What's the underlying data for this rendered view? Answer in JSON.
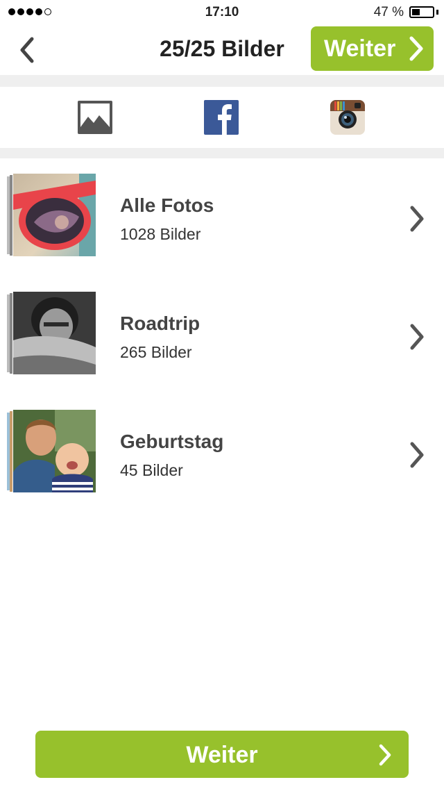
{
  "status": {
    "time": "17:10",
    "battery": "47 %",
    "battery_level": 0.47
  },
  "nav": {
    "title": "25/25 Bilder",
    "next_label": "Weiter"
  },
  "source_tabs": [
    {
      "icon": "gallery-icon",
      "selected": true
    },
    {
      "icon": "facebook-icon",
      "selected": false
    },
    {
      "icon": "instagram-icon",
      "selected": false
    }
  ],
  "albums": [
    {
      "name": "Alle Fotos",
      "count": "1028 Bilder",
      "icon": "photo-sunglasses"
    },
    {
      "name": "Roadtrip",
      "count": "265 Bilder",
      "icon": "photo-man-bw"
    },
    {
      "name": "Geburtstag",
      "count": "45 Bilder",
      "icon": "photo-father-baby"
    }
  ],
  "footer": {
    "next_label": "Weiter"
  },
  "colors": {
    "accent": "#97c12c",
    "separator": "#efefef",
    "facebook": "#3b5998"
  }
}
